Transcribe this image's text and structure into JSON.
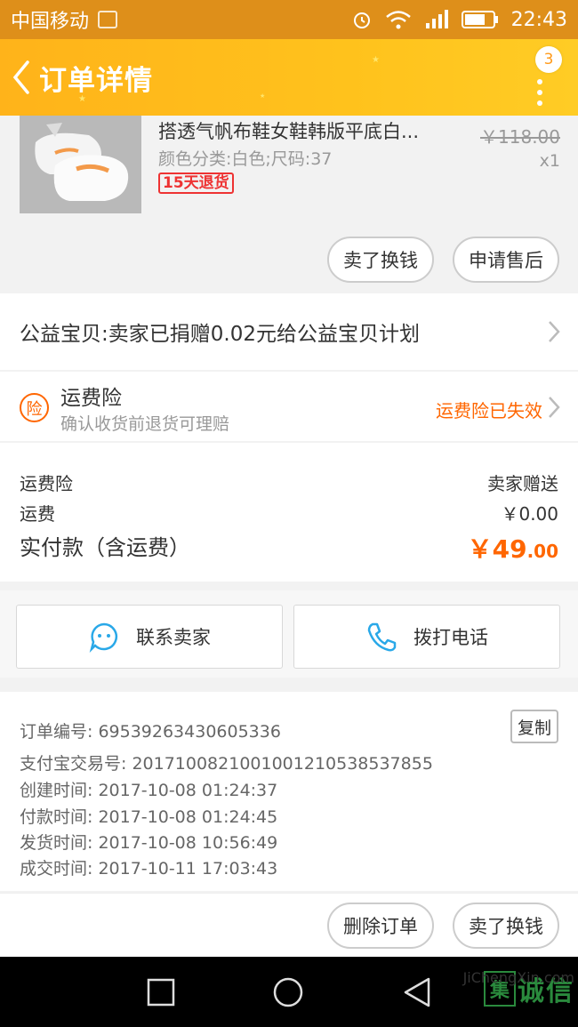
{
  "statusbar": {
    "carrier": "中国移动",
    "time": "22:43"
  },
  "header": {
    "title": "订单详情",
    "badge_count": "3"
  },
  "product": {
    "name": "搭透气帆布鞋女鞋韩版平底白...",
    "attributes": "颜色分类:白色;尺码:37",
    "return_tag": "15天退货",
    "original_price": "￥118.00",
    "quantity": "x1",
    "actions": {
      "sell": "卖了换钱",
      "after_sale": "申请售后"
    }
  },
  "donation": {
    "text": "公益宝贝:卖家已捐赠0.02元给公益宝贝计划"
  },
  "insurance": {
    "icon_text": "险",
    "title": "运费险",
    "subtitle": "确认收货前退货可理赔",
    "status": "运费险已失效"
  },
  "fees": {
    "insurance_label": "运费险",
    "insurance_value": "卖家赠送",
    "shipping_label": "运费",
    "shipping_value": "￥0.00",
    "total_label": "实付款（含运费）",
    "total_currency": "￥",
    "total_integer": "49",
    "total_decimal": ".00"
  },
  "contact": {
    "seller": "联系卖家",
    "call": "拨打电话"
  },
  "order_info": {
    "order_no": "订单编号: 69539263430605336",
    "copy_label": "复制",
    "alipay_no": "支付宝交易号: 2017100821001001210538537855",
    "created": "创建时间: 2017-10-08 01:24:37",
    "paid": "付款时间: 2017-10-08 01:24:45",
    "shipped": "发货时间: 2017-10-08 10:56:49",
    "completed": "成交时间: 2017-10-11 17:03:43"
  },
  "bottom_actions": {
    "delete": "删除订单",
    "sell": "卖了换钱"
  },
  "watermark": {
    "char": "集",
    "text": "诚信",
    "site": "JiChengXin.com"
  },
  "colors": {
    "accent": "#ff6600",
    "header": "#ffbb1c",
    "statusbar": "#de8f1a"
  }
}
